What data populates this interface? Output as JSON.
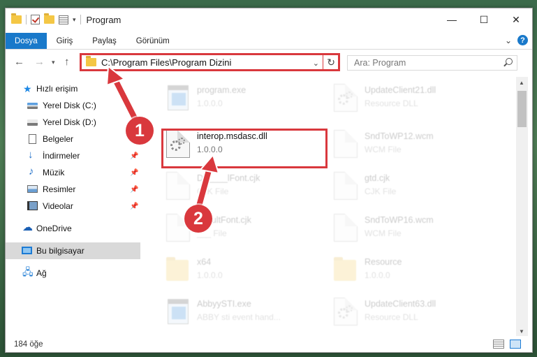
{
  "window": {
    "title": "Program",
    "controls": {
      "minimize": "—",
      "maximize": "☐",
      "close": "✕"
    }
  },
  "ribbon": {
    "tabs": [
      "Dosya",
      "Giriş",
      "Paylaş",
      "Görünüm"
    ],
    "help": "?"
  },
  "address": {
    "path": "C:\\Program Files\\Program Dizini",
    "search_placeholder": "Ara: Program"
  },
  "sidebar": {
    "items": [
      {
        "label": "Hızlı erişim",
        "icon": "star-icon"
      },
      {
        "label": "Yerel Disk (C:)",
        "icon": "drive-icon"
      },
      {
        "label": "Yerel Disk (D:)",
        "icon": "drive-icon"
      },
      {
        "label": "Belgeler",
        "icon": "document-icon",
        "pinned": true
      },
      {
        "label": "İndirmeler",
        "icon": "download-icon",
        "pinned": true
      },
      {
        "label": "Müzik",
        "icon": "music-icon",
        "pinned": true
      },
      {
        "label": "Resimler",
        "icon": "pictures-icon",
        "pinned": true
      },
      {
        "label": "Videolar",
        "icon": "videos-icon",
        "pinned": true
      },
      {
        "label": "OneDrive",
        "icon": "cloud-icon"
      },
      {
        "label": "Bu bilgisayar",
        "icon": "computer-icon",
        "selected": true
      },
      {
        "label": "Ağ",
        "icon": "network-icon"
      }
    ]
  },
  "files": [
    {
      "name": "program.exe",
      "sub": "1.0.0.0",
      "type": "exe"
    },
    {
      "name": "UpdateClient21.dll",
      "sub": "Resource DLL",
      "type": "dll"
    },
    {
      "name": "interop.msdasc.dll",
      "sub": "1.0.0.0",
      "type": "dll",
      "highlighted": true
    },
    {
      "name": "SndToWP12.wcm",
      "sub": "WCM File",
      "type": "page"
    },
    {
      "name": "D_____lFont.cjk",
      "sub": "CJK File",
      "type": "page"
    },
    {
      "name": "gtd.cjk",
      "sub": "CJK File",
      "type": "page"
    },
    {
      "name": "___ultFont.cjk",
      "sub": "___ File",
      "type": "page"
    },
    {
      "name": "SndToWP16.wcm",
      "sub": "WCM File",
      "type": "page"
    },
    {
      "name": "x64",
      "sub": "1.0.0.0",
      "type": "folder"
    },
    {
      "name": "Resource",
      "sub": "1.0.0.0",
      "type": "folder"
    },
    {
      "name": "AbbyySTI.exe",
      "sub": "ABBY sti event hand...",
      "type": "exe"
    },
    {
      "name": "UpdateClient63.dll",
      "sub": "Resource DLL",
      "type": "dll"
    }
  ],
  "status": {
    "count": "184 öğe"
  },
  "annotations": {
    "step1": "1",
    "step2": "2",
    "color": "#d9383d"
  }
}
